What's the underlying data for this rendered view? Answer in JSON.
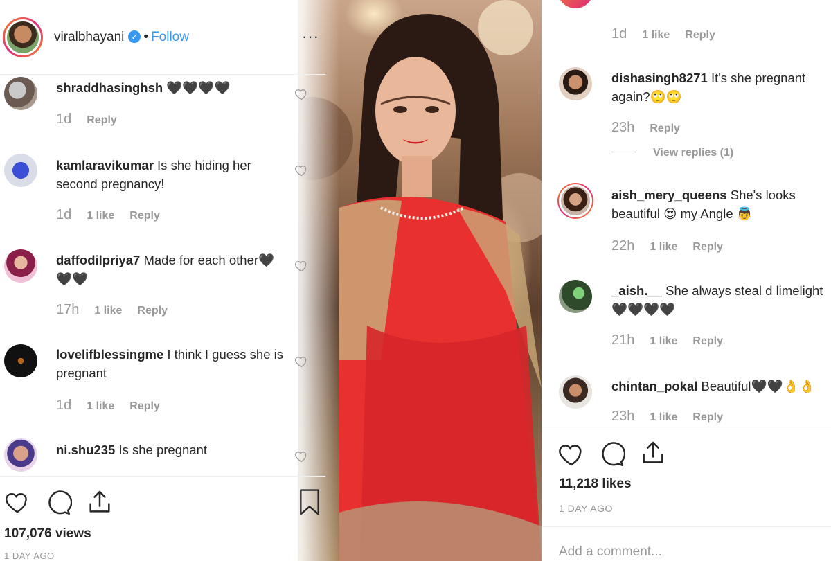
{
  "header": {
    "username": "viralbhayani",
    "verified_icon": "verified-badge-icon",
    "separator": "•",
    "follow_label": "Follow",
    "more_label": "···"
  },
  "left_comments": [
    {
      "user": "shraddhasinghsh",
      "text": "🖤🖤🖤🖤",
      "time": "1d",
      "likes": "",
      "reply": "Reply"
    },
    {
      "user": "kamlaravikumar",
      "text": "Is she hiding her second pregnancy!",
      "time": "1d",
      "likes": "1 like",
      "reply": "Reply"
    },
    {
      "user": "daffodilpriya7",
      "text": "Made for each other🖤🖤🖤",
      "time": "17h",
      "likes": "1 like",
      "reply": "Reply"
    },
    {
      "user": "lovelifblessingme",
      "text": "I think I guess she is pregnant",
      "time": "1d",
      "likes": "1 like",
      "reply": "Reply"
    },
    {
      "user": "ni.shu235",
      "text": "Is she pregnant",
      "time": "",
      "likes": "",
      "reply": ""
    }
  ],
  "left_footer": {
    "views": "107,076 views",
    "posted": "1 DAY AGO"
  },
  "right_top_meta": {
    "time": "1d",
    "likes": "1 like",
    "reply": "Reply"
  },
  "right_comments": [
    {
      "user": "dishasingh8271",
      "text": "It's she pregnant again?🙄🙄",
      "time": "23h",
      "likes": "",
      "reply": "Reply"
    },
    {
      "user": "aish_mery_queens",
      "text": "She's looks beautiful 😍 my Angle 👼",
      "time": "22h",
      "likes": "1 like",
      "reply": "Reply"
    },
    {
      "user": "_aish.__",
      "text": "She always steal d limelight 🖤🖤🖤🖤",
      "time": "21h",
      "likes": "1 like",
      "reply": "Reply"
    },
    {
      "user": "chintan_pokal",
      "text": "Beautiful🖤🖤👌👌",
      "time": "23h",
      "likes": "1 like",
      "reply": "Reply"
    }
  ],
  "view_replies": "View replies (1)",
  "right_footer": {
    "likes": "11,218 likes",
    "posted": "1 DAY AGO",
    "add_comment_placeholder": "Add a comment..."
  },
  "colors": {
    "accent": "#3897f0",
    "muted": "#999999",
    "text": "#262626",
    "saree": "#e8302e"
  }
}
